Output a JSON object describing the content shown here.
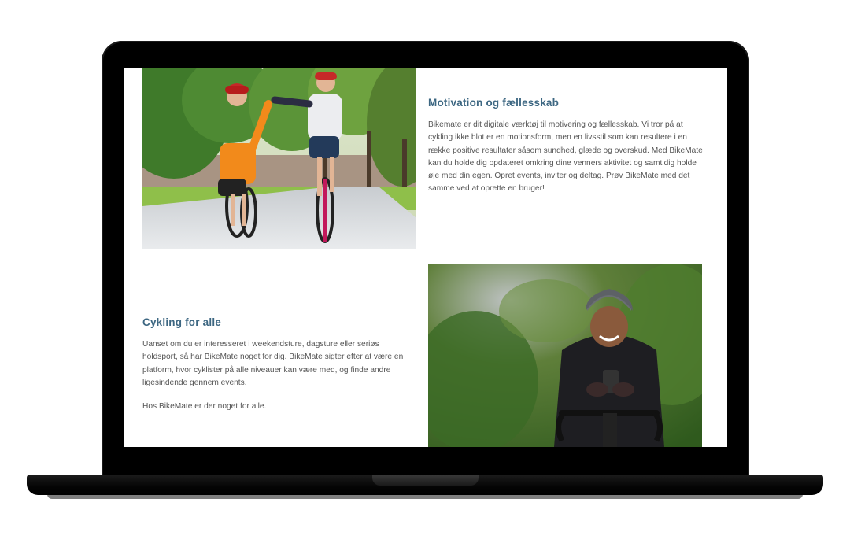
{
  "sections": [
    {
      "heading": "Motivation og fællesskab",
      "paragraphs": [
        "Bikemate er dit digitale værktøj til motivering og fællesskab. Vi tror på at cykling ikke blot er en motionsform, men en livsstil som kan resultere i en række positive resultater såsom sundhed, glæde og overskud. Med BikeMate kan du holde dig opdateret omkring dine venners aktivitet og samtidig holde øje med din egen. Opret events, inviter og deltag. Prøv BikeMate med det samme ved at oprette en bruger!"
      ],
      "image": "two-cyclists-high-five-photo"
    },
    {
      "heading": "Cykling for alle",
      "paragraphs": [
        "Uanset om du er interesseret i weekendsture, dagsture eller seriøs holdsport, så har BikeMate noget for dig. BikeMate sigter efter at være en platform, hvor cyklister på alle niveauer kan være med, og finde andre ligesindende gennem events.",
        "Hos BikeMate er der noget for alle."
      ],
      "image": "woman-cyclist-phone-photo"
    }
  ],
  "colors": {
    "heading": "#3d6782",
    "body_text": "#555555",
    "laptop_frame": "#000000",
    "screen_bg": "#ffffff"
  }
}
